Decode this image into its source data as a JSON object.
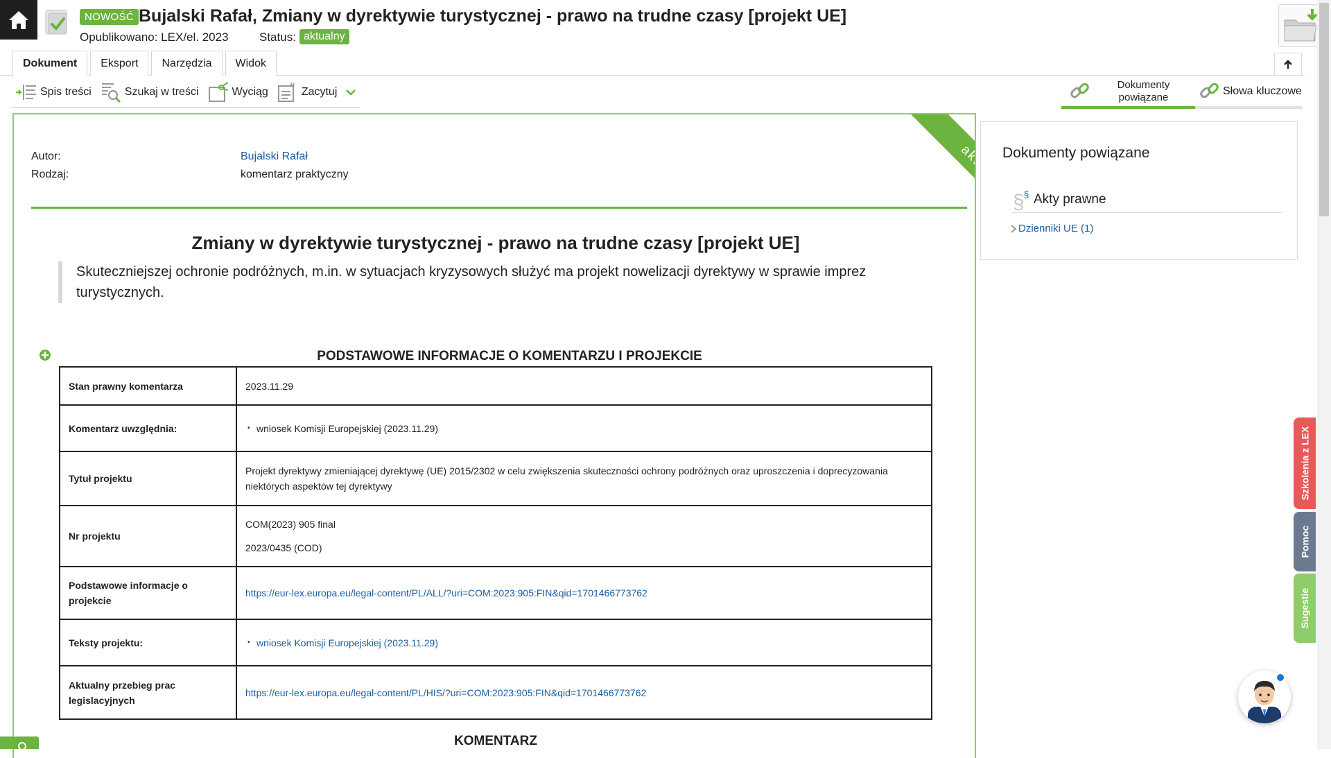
{
  "header": {
    "badge_new": "NOWOŚĆ",
    "title": "Bujalski Rafał, Zmiany w dyrektywie turystycznej - prawo na trudne czasy [projekt UE]",
    "published": "Opublikowano: LEX/el. 2023",
    "status_label": "Status:",
    "status_value": "aktualny",
    "icons": [
      "home-icon",
      "document-check-icon",
      "folder-download-icon"
    ]
  },
  "tabs": [
    "Dokument",
    "Eksport",
    "Narzędzia",
    "Widok"
  ],
  "toolbar": {
    "items": [
      "Spis treści",
      "Szukaj w treści",
      "Wyciąg",
      "Zacytuj"
    ],
    "related_docs": "Dokumenty powiązane",
    "related_docs_line1": "Dokumenty",
    "related_docs_line2": "powiązane",
    "keywords": "Słowa kluczowe"
  },
  "document": {
    "ribbon": "aktualny",
    "meta": {
      "author_label": "Autor:",
      "author_value": "Bujalski Rafał",
      "type_label": "Rodzaj:",
      "type_value": "komentarz praktyczny"
    },
    "title": "Zmiany w dyrektywie turystycznej - prawo na trudne czasy [projekt UE]",
    "lead": "Skuteczniejszej ochronie podróżnych, m.in. w sytuacjach kryzysowych służyć ma projekt nowelizacji dyrektywy w sprawie imprez turystycznych.",
    "section_title": "PODSTAWOWE INFORMACJE O KOMENTARZU I PROJEKCIE",
    "table": {
      "r1_key": "Stan prawny komentarza",
      "r1_val": "2023.11.29",
      "r2_key": "Komentarz uwzględnia:",
      "r2_val": "wniosek Komisji Europejskiej (2023.11.29)",
      "r3_key": "Tytuł projektu",
      "r3_val": "Projekt dyrektywy zmieniającej dyrektywę (UE) 2015/2302 w celu zwiększenia skuteczności ochrony podróżnych oraz uproszczenia i doprecyzowania niektórych aspektów tej dyrektywy",
      "r4_key": "Nr projektu",
      "r4_val1": "COM(2023) 905 final",
      "r4_val2": "2023/0435 (COD)",
      "r5_key": "Podstawowe informacje o projekcie",
      "r5_val": "https://eur-lex.europa.eu/legal-content/PL/ALL/?uri=COM:2023:905:FIN&qid=1701466773762",
      "r6_key": "Teksty projektu:",
      "r6_val": "wniosek Komisji Europejskiej (2023.11.29)",
      "r7_key": "Aktualny przebieg prac legislacyjnych",
      "r7_val": "https://eur-lex.europa.eu/legal-content/PL/HIS/?uri=COM:2023:905:FIN&qid=1701466773762"
    },
    "comment_title": "KOMENTARZ"
  },
  "related": {
    "title": "Dokumenty powiązane",
    "group": "Akty prawne",
    "item": "Dzienniki UE (1)"
  },
  "side_tabs": {
    "szkolenia": "Szkolenia z LEX",
    "pomoc": "Pomoc",
    "sugestie": "Sugestie"
  },
  "colors": {
    "accent_green": "#6cb33f",
    "link_blue": "#1a5c9e",
    "tab_red": "#e85a5a",
    "tab_gray": "#6b7a8f",
    "tab_light_green": "#8fcc6a"
  }
}
